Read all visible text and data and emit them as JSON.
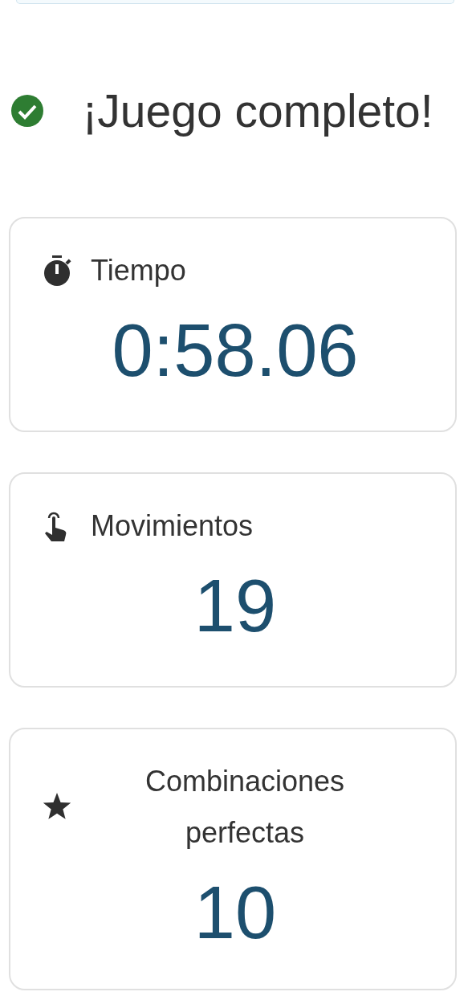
{
  "heading": {
    "title": "¡Juego completo!"
  },
  "stats": [
    {
      "kind": "time",
      "label": "Tiempo",
      "value": "0:58.06"
    },
    {
      "kind": "moves",
      "label": "Movimientos",
      "value": "19"
    },
    {
      "kind": "star",
      "label": "Combinaciones perfectas",
      "value": "10"
    }
  ]
}
